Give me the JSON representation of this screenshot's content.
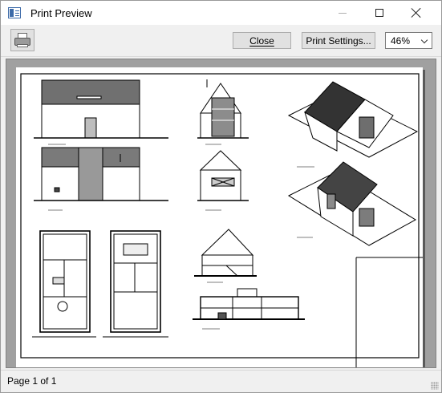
{
  "window": {
    "title": "Print Preview"
  },
  "toolbar": {
    "close_label": "Close",
    "print_settings_label": "Print Settings...",
    "zoom_value": "46%"
  },
  "status": {
    "page_text": "Page 1 of 1"
  }
}
